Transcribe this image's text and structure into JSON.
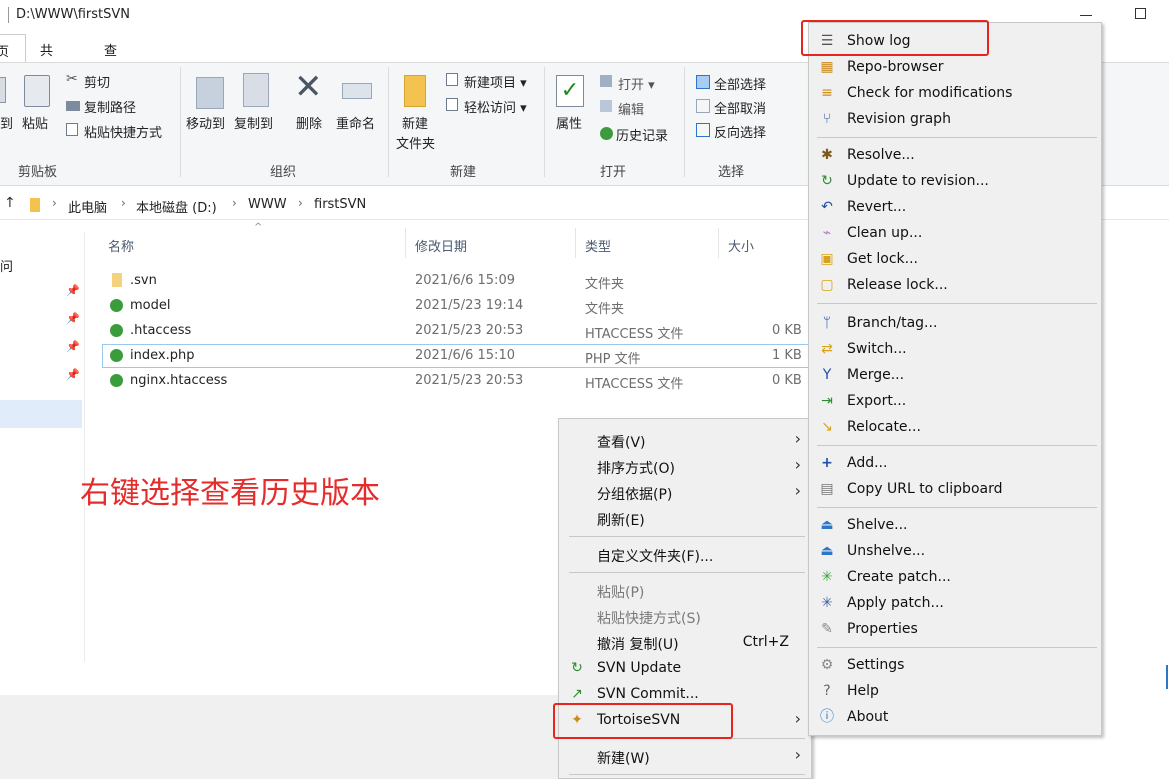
{
  "window": {
    "title": "D:\\WWW\\firstSVN"
  },
  "ribbon": {
    "tabs": [
      "页",
      "共享",
      "查看"
    ],
    "clipboard": {
      "label": "剪贴板",
      "copy_cut": "剪切",
      "copy_path": "复制路径",
      "paste": "粘贴",
      "paste_shortcut": "粘贴快捷方式",
      "partial": "到"
    },
    "organize": {
      "label": "组织",
      "move_to": "移动到",
      "copy_to": "复制到",
      "delete": "删除",
      "rename": "重命名"
    },
    "new": {
      "label": "新建",
      "new_folder_line1": "新建",
      "new_folder_line2": "文件夹",
      "new_item": "新建项目",
      "easy_access": "轻松访问"
    },
    "open": {
      "label": "打开",
      "properties": "属性",
      "open": "打开",
      "edit": "编辑",
      "history": "历史记录"
    },
    "select": {
      "label": "选择",
      "select_all": "全部选择",
      "select_none": "全部取消",
      "invert": "反向选择"
    }
  },
  "address": {
    "crumbs": [
      "此电脑",
      "本地磁盘 (D:)",
      "WWW",
      "firstSVN"
    ]
  },
  "sidebar": {
    "partial_label": "问"
  },
  "file_list": {
    "columns": [
      "名称",
      "修改日期",
      "类型",
      "大小"
    ],
    "rows": [
      {
        "name": ".svn",
        "date": "2021/6/6 15:09",
        "type": "文件夹",
        "size": ""
      },
      {
        "name": "model",
        "date": "2021/5/23 19:14",
        "type": "文件夹",
        "size": ""
      },
      {
        "name": ".htaccess",
        "date": "2021/5/23 20:53",
        "type": "HTACCESS 文件",
        "size": "0 KB"
      },
      {
        "name": "index.php",
        "date": "2021/6/6 15:10",
        "type": "PHP 文件",
        "size": "1 KB"
      },
      {
        "name": "nginx.htaccess",
        "date": "2021/5/23 20:53",
        "type": "HTACCESS 文件",
        "size": "0 KB"
      }
    ]
  },
  "annotation": "右键选择查看历史版本",
  "context_menu": {
    "items": [
      "查看(V)",
      "排序方式(O)",
      "分组依据(P)",
      "刷新(E)",
      "自定义文件夹(F)...",
      "粘贴(P)",
      "粘贴快捷方式(S)",
      "撤消 复制(U)",
      "SVN Update",
      "SVN Commit...",
      "TortoiseSVN",
      "新建(W)"
    ],
    "undo_shortcut": "Ctrl+Z"
  },
  "svn_menu": {
    "items": [
      "Show log",
      "Repo-browser",
      "Check for modifications",
      "Revision graph",
      "Resolve...",
      "Update to revision...",
      "Revert...",
      "Clean up...",
      "Get lock...",
      "Release lock...",
      "Branch/tag...",
      "Switch...",
      "Merge...",
      "Export...",
      "Relocate...",
      "Add...",
      "Copy URL to clipboard",
      "Shelve...",
      "Unshelve...",
      "Create patch...",
      "Apply patch...",
      "Properties",
      "Settings",
      "Help",
      "About"
    ]
  },
  "colors": {
    "highlight_box": "#e8241c",
    "annotation": "#e62b2b",
    "menu_bg": "#f0f0f0"
  }
}
